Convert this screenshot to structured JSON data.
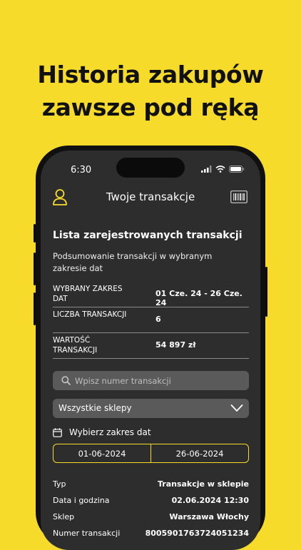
{
  "headline": {
    "line1": "Historia zakupów",
    "line2": "zawsze pod ręką"
  },
  "status_bar": {
    "time": "6:30"
  },
  "app_bar": {
    "title": "Twoje transakcje",
    "left_icon": "user-icon",
    "right_icon": "barcode-icon"
  },
  "section": {
    "title": "Lista zarejestrowanych transakcji",
    "subtitle": "Podsumowanie transakcji w wybranym zakresie dat"
  },
  "summary": [
    {
      "label": "Wybrany zakres dat",
      "value": "01 Cze. 24 - 26 Cze. 24"
    },
    {
      "label": "Liczba transakcji",
      "value": "6"
    },
    {
      "label": "Wartość transakcji",
      "value": "54 897 zł"
    }
  ],
  "search": {
    "placeholder": "Wpisz numer transakcji",
    "icon": "search-icon"
  },
  "store_filter": {
    "selected": "Wszystkie sklepy",
    "icon": "chevron-down-icon"
  },
  "date_range": {
    "label": "Wybierz zakres dat",
    "icon": "calendar-icon",
    "from": "01-06-2024",
    "to": "26-06-2024"
  },
  "transaction": [
    {
      "label": "Typ",
      "value": "Transakcje w sklepie"
    },
    {
      "label": "Data i godzina",
      "value": "02.06.2024 12:30"
    },
    {
      "label": "Sklep",
      "value": "Warszawa Włochy"
    },
    {
      "label": "Numer transakcji",
      "value": "8005901763724051234"
    }
  ],
  "colors": {
    "background": "#F7DB2B",
    "accent": "#F7DB2B",
    "screen": "#2E2D2D",
    "field": "#5b5a5a"
  }
}
